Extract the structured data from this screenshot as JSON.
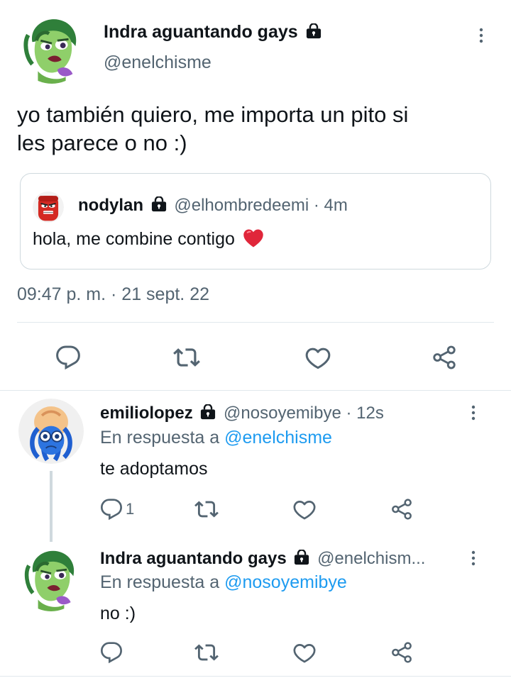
{
  "main_tweet": {
    "display_name": "Indra aguantando gays",
    "handle": "@enelchisme",
    "text_line1": "yo también quiero, me importa un pito si",
    "text_line2": "les parece o no :)",
    "quoted": {
      "display_name": "nodylan",
      "handle": "@elhombredeemi",
      "separator": "·",
      "time": "4m",
      "text": "hola, me combine contigo"
    },
    "timestamp": "09:47 p. m. · 21 sept. 22"
  },
  "replies": [
    {
      "display_name": "emiliolopez",
      "handle": "@nosoyemibye",
      "separator": "·",
      "time": "12s",
      "reply_prefix": "En respuesta a",
      "reply_to": "@enelchisme",
      "text": "te adoptamos",
      "reply_count": "1"
    },
    {
      "display_name": "Indra aguantando gays",
      "handle": "@enelchism...",
      "reply_prefix": "En respuesta a",
      "reply_to": "@nosoyemibye",
      "text": "no :)",
      "reply_count": ""
    }
  ],
  "icons": [
    "lock-icon",
    "more-icon",
    "reply-icon",
    "retweet-icon",
    "like-icon",
    "share-icon",
    "heart-emoji-icon"
  ],
  "colors": {
    "text": "#0f1419",
    "secondary": "#536471",
    "link": "#1d9bf0",
    "divider": "#e1e8ed",
    "heart": "#f4212e"
  }
}
